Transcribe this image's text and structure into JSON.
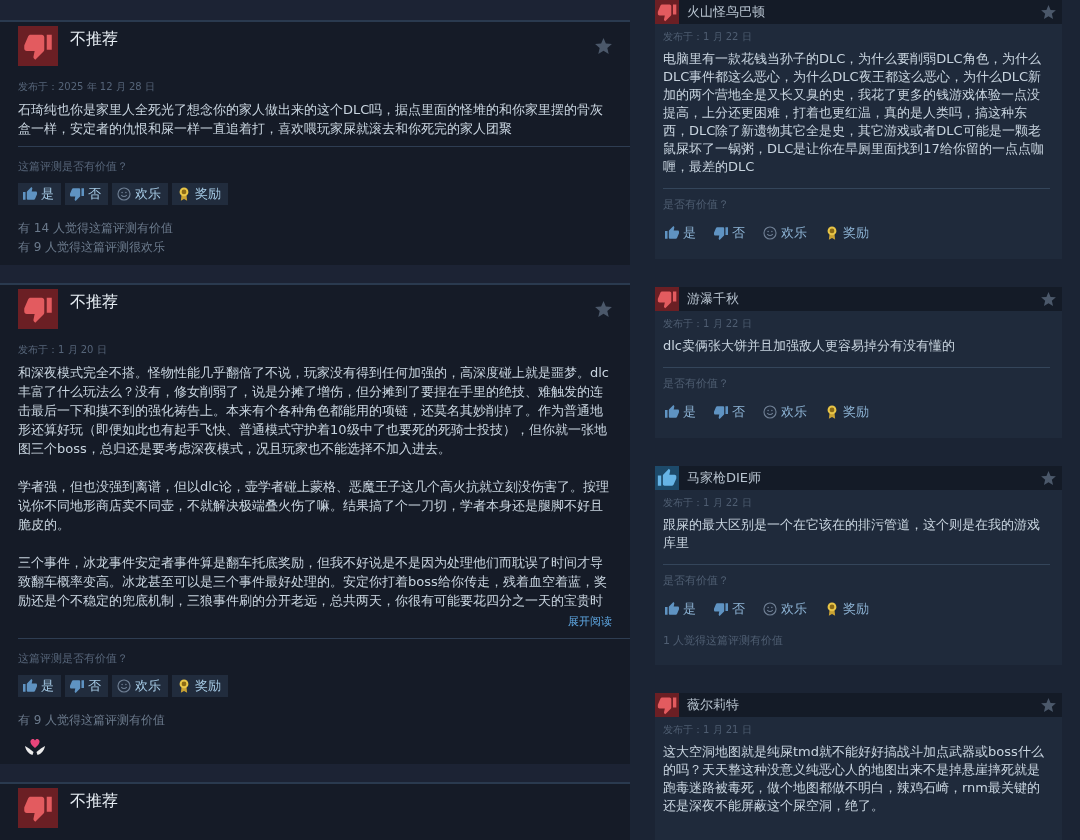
{
  "left_reviews": [
    {
      "recommended": false,
      "verdict": "不推荐",
      "date": "发布于：2025 年 12 月 28 日",
      "paragraphs": [
        "石琦纯也你是家里人全死光了想念你的家人做出来的这个DLC吗，据点里面的怪堆的和你家里摆的骨灰盒一样，安定者的仇恨和屎一样一直追着打，喜欢喂玩家屎就滚去和你死完的家人团聚"
      ],
      "helpful_prompt": "这篇评测是否有价值？",
      "vote_buttons": [
        {
          "kind": "yes",
          "label": "是"
        },
        {
          "kind": "no",
          "label": "否"
        },
        {
          "kind": "funny",
          "label": "欢乐"
        },
        {
          "kind": "award",
          "label": "奖励"
        }
      ],
      "stats": [
        "有 14 人觉得这篇评测有价值",
        "有 9 人觉得这篇评测很欢乐"
      ]
    },
    {
      "recommended": false,
      "verdict": "不推荐",
      "date": "发布于：1 月 20 日",
      "paragraphs": [
        "和深夜模式完全不搭。怪物性能几乎翻倍了不说，玩家没有得到任何加强的，高深度碰上就是噩梦。dlc丰富了什么玩法么？没有，修女削弱了，说是分摊了增伤，但分摊到了要捏在手里的绝技、难触发的连击最后一下和摸不到的强化祷告上。本来有个各种角色都能用的项链，还莫名其妙削掉了。作为普通地形还算好玩（即便如此也有起手飞快、普通模式守护着10级中了也要死的死骑士投技），但你就一张地图三个boss，总归还是要考虑深夜模式，况且玩家也不能选择不加入进去。",
        "学者强，但也没强到离谱，但以dlc论，壶学者碰上蒙格、恶魔王子这几个高火抗就立刻没伤害了。按理说你不同地形商店卖不同壶，不就解决极端叠火伤了嘛。结果搞了个一刀切，学者本身还是腿脚不好且脆皮的。",
        "三个事件，冰龙事件安定者事件算是翻车托底奖励，但我不好说是不是因为处理他们而耽误了时间才导致翻车概率变高。冰龙甚至可以是三个事件最好处理的。安定你打着boss给你传走，残着血空着蓝，奖励还是个不稳定的兜底机制，三狼事件刷的分开老远，总共两天，你很有可能要花四分之一天的宝贵时"
      ],
      "read_more": "展开阅读",
      "helpful_prompt": "这篇评测是否有价值？",
      "vote_buttons": [
        {
          "kind": "yes",
          "label": "是"
        },
        {
          "kind": "no",
          "label": "否"
        },
        {
          "kind": "funny",
          "label": "欢乐"
        },
        {
          "kind": "award",
          "label": "奖励"
        }
      ],
      "stats": [
        "有 9 人觉得这篇评测有价值"
      ],
      "awards": [
        {
          "kind": "heart_hands"
        }
      ]
    },
    {
      "recommended": false,
      "verdict": "不推荐"
    }
  ],
  "right_reviews": [
    {
      "recommended": false,
      "author": "火山怪鸟巴顿",
      "date": "发布于：1 月 22 日",
      "text": "电脑里有一款花钱当孙子的DLC，为什么要削弱DLC角色，为什么DLC事件都这么恶心，为什么DLC夜王都这么恶心，为什么DLC新加的两个营地全是又长又臭的史，我花了更多的钱游戏体验一点没提高，上分还更困难，打着也更红温，真的是人类吗，搞这种东西，DLC除了新遗物其它全是史，其它游戏或者DLC可能是一颗老鼠屎坏了一锅粥，DLC是让你在旱厕里面找到17给你留的一点点咖喱，最差的DLC",
      "helpful_prompt": "是否有价值？",
      "vote_buttons": [
        {
          "kind": "yes",
          "label": "是"
        },
        {
          "kind": "no",
          "label": "否"
        },
        {
          "kind": "funny",
          "label": "欢乐"
        },
        {
          "kind": "award",
          "label": "奖励"
        }
      ]
    },
    {
      "recommended": false,
      "author": "游瀑千秋",
      "date": "发布于：1 月 22 日",
      "text": "dlc卖俩张大饼并且加强敌人更容易掉分有没有懂的",
      "helpful_prompt": "是否有价值？",
      "vote_buttons": [
        {
          "kind": "yes",
          "label": "是"
        },
        {
          "kind": "no",
          "label": "否"
        },
        {
          "kind": "funny",
          "label": "欢乐"
        },
        {
          "kind": "award",
          "label": "奖励"
        }
      ]
    },
    {
      "recommended": true,
      "author": "马家枪DIE师",
      "date": "发布于：1 月 22 日",
      "text": "跟屎的最大区别是一个在它该在的排污管道，这个则是在我的游戏库里",
      "helpful_prompt": "是否有价值？",
      "vote_buttons": [
        {
          "kind": "yes",
          "label": "是"
        },
        {
          "kind": "no",
          "label": "否"
        },
        {
          "kind": "funny",
          "label": "欢乐"
        },
        {
          "kind": "award",
          "label": "奖励"
        }
      ],
      "stats": [
        "1 人觉得这篇评测有价值"
      ]
    },
    {
      "recommended": false,
      "author": "薇尔莉特",
      "date": "发布于：1 月 21 日",
      "text": "这大空洞地图就是纯屎tmd就不能好好搞战斗加点武器或boss什么的吗？天天整这种没意义纯恶心人的地图出来不是掉悬崖摔死就是跑毒迷路被毒死，做个地图都做不明白，辣鸡石崎，rnm最关键的还是深夜不能屏蔽这个屎空洞，绝了。"
    }
  ]
}
